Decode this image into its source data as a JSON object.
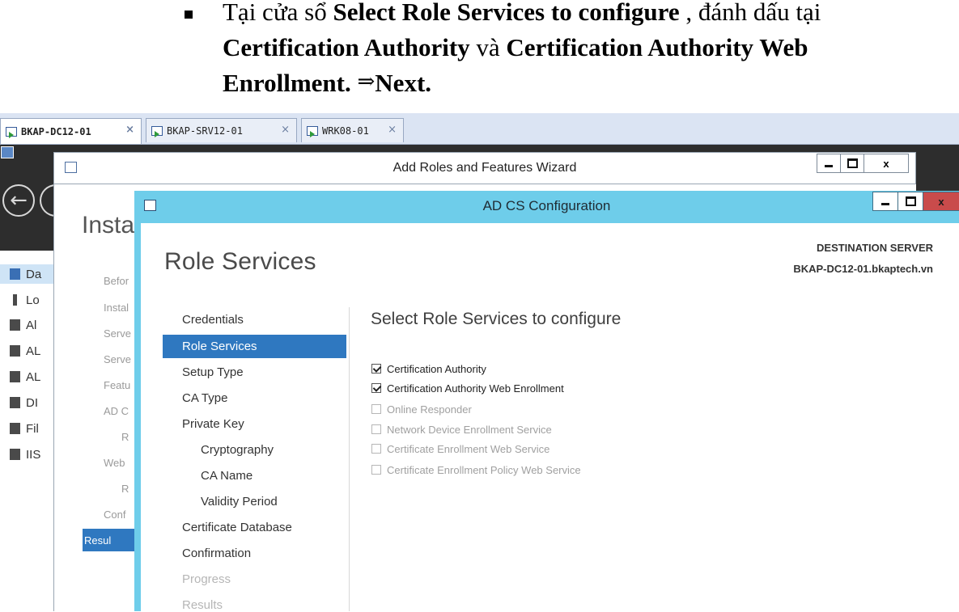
{
  "caption": {
    "line1_prefix": "Tại cửa sổ ",
    "line1_bold": "Select Role Services to configure",
    "line1_suffix": " , đánh dấu tại",
    "line2_bold_a": "Certification Authority",
    "line2_mid": " và ",
    "line2_bold_b": "Certification Authority Web",
    "line3_bold": "Enrollment.",
    "line3_arrow": "⇒",
    "line3_next": "Next."
  },
  "vm_tabs": [
    {
      "label": "BKAP-DC12-01",
      "active": true
    },
    {
      "label": "BKAP-SRV12-01",
      "active": false
    },
    {
      "label": "WRK08-01",
      "active": false
    }
  ],
  "tab_close_glyph": "×",
  "server_manager": {
    "sidebar": [
      "Da",
      "Lo",
      "Al",
      "AL",
      "AL",
      "DI",
      "Fil",
      "IIS"
    ]
  },
  "wizard": {
    "title": "Add Roles and Features Wizard",
    "heading": "Insta",
    "close_label": "x",
    "steps": [
      "Befor",
      "Instal",
      "Serve",
      "Serve",
      "Featu",
      "AD C",
      "R",
      "Web",
      "R",
      "Conf",
      "Resul"
    ]
  },
  "adcs": {
    "title": "AD CS Configuration",
    "close_label": "x",
    "page_heading": "Role Services",
    "destination_label": "DESTINATION SERVER",
    "destination_value": "BKAP-DC12-01.bkaptech.vn",
    "nav": [
      {
        "label": "Credentials",
        "state": "normal",
        "sub": false
      },
      {
        "label": "Role Services",
        "state": "active",
        "sub": false
      },
      {
        "label": "Setup Type",
        "state": "normal",
        "sub": false
      },
      {
        "label": "CA Type",
        "state": "normal",
        "sub": false
      },
      {
        "label": "Private Key",
        "state": "normal",
        "sub": false
      },
      {
        "label": "Cryptography",
        "state": "normal",
        "sub": true
      },
      {
        "label": "CA Name",
        "state": "normal",
        "sub": true
      },
      {
        "label": "Validity Period",
        "state": "normal",
        "sub": true
      },
      {
        "label": "Certificate Database",
        "state": "normal",
        "sub": false
      },
      {
        "label": "Confirmation",
        "state": "normal",
        "sub": false
      },
      {
        "label": "Progress",
        "state": "disabled",
        "sub": false
      },
      {
        "label": "Results",
        "state": "disabled",
        "sub": false
      }
    ],
    "content_heading": "Select Role Services to configure",
    "role_services": [
      {
        "label": "Certification Authority",
        "checked": true,
        "enabled": true
      },
      {
        "label": "Certification Authority Web Enrollment",
        "checked": true,
        "enabled": true
      },
      {
        "label": "Online Responder",
        "checked": false,
        "enabled": false
      },
      {
        "label": "Network Device Enrollment Service",
        "checked": false,
        "enabled": false
      },
      {
        "label": "Certificate Enrollment Web Service",
        "checked": false,
        "enabled": false
      },
      {
        "label": "Certificate Enrollment Policy Web Service",
        "checked": false,
        "enabled": false
      }
    ]
  }
}
